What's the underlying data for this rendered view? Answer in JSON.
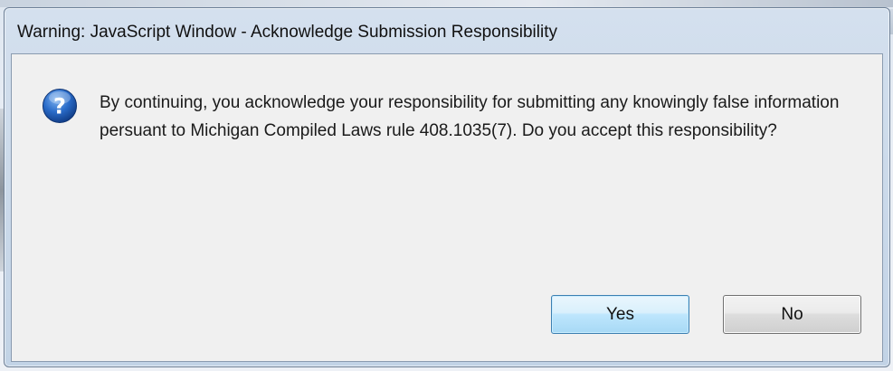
{
  "dialog": {
    "title": "Warning: JavaScript Window - Acknowledge Submission Responsibility",
    "icon": "question-icon",
    "message": "By continuing, you acknowledge your responsibility for submitting any knowingly false information persuant to Michigan Compiled Laws rule 408.1035(7). Do you accept this responsibility?",
    "buttons": {
      "yes_label": "Yes",
      "no_label": "No"
    }
  },
  "colors": {
    "icon_blue": "#1f5fb8",
    "default_button_border": "#3c7fb1"
  }
}
